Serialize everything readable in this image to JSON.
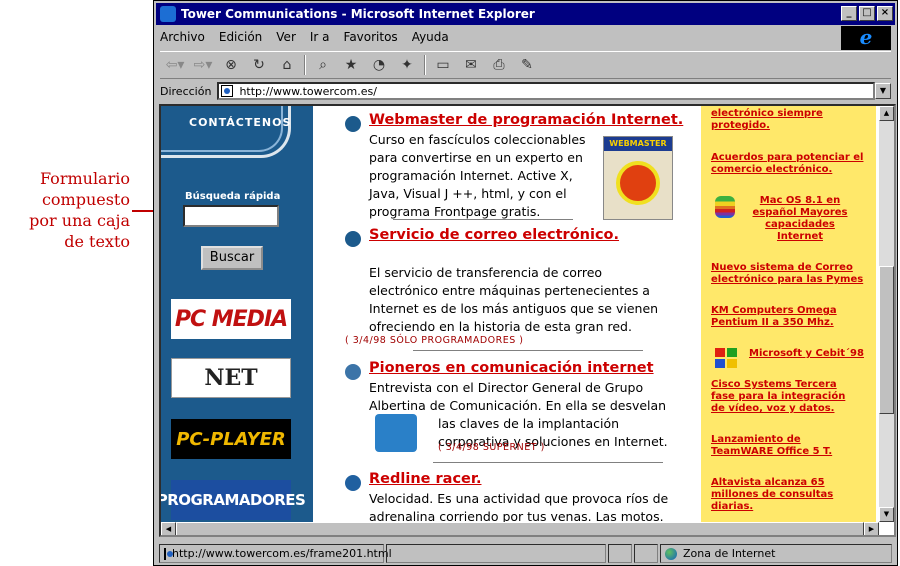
{
  "annotation": {
    "lines": [
      "Formulario",
      "compuesto",
      "por una caja",
      "de texto"
    ]
  },
  "window": {
    "title": "Tower Communications - Microsoft Internet Explorer",
    "buttons": [
      "_",
      "□",
      "×"
    ]
  },
  "menu": [
    "Archivo",
    "Edición",
    "Ver",
    "Ir a",
    "Favoritos",
    "Ayuda"
  ],
  "toolbar_icons": [
    "back-arrow-icon",
    "forward-arrow-icon",
    "stop-icon",
    "refresh-icon",
    "home-icon",
    "search-icon",
    "favorites-icon",
    "history-icon",
    "channels-icon",
    "fullscreen-icon",
    "mail-icon",
    "print-icon",
    "edit-icon"
  ],
  "address": {
    "label": "Dirección",
    "url": "http://www.towercom.es/"
  },
  "left": {
    "heading": "CONTÁCTENOS",
    "search_label": "Búsqueda rápida",
    "search_value": "",
    "button": "Buscar",
    "banners": [
      "PC MEDIA",
      "NET",
      "PC-PLAYER",
      "PROGRAMADORES"
    ]
  },
  "articles": [
    {
      "title": "Webmaster de programación Internet.",
      "lines": [
        "Curso en fascículos coleccionables",
        "para convertirse en un experto en",
        "programación Internet. Active X,",
        "Java, Visual J ++, html, y con el",
        "programa Frontpage gratis."
      ],
      "date": ""
    },
    {
      "title": "Servicio de correo electrónico.",
      "lines": [
        "El servicio de transferencia de correo",
        "electrónico entre máquinas pertenecientes a",
        "Internet es de los más antiguos que se vienen",
        "ofreciendo en la historia de esta gran red."
      ],
      "date": "( 3/4/98 SÓLO PROGRAMADORES )"
    },
    {
      "title": "Pioneros en comunicación internet",
      "lines": [
        "Entrevista con el Director General de Grupo",
        "Albertina de Comunicación. En ella se desvelan",
        "las claves de la implantación",
        "corporativa y soluciones en Internet."
      ],
      "date": "( 3/4/98 SUPERNET )"
    },
    {
      "title": "Redline racer.",
      "lines": [
        "Velocidad. Es una actividad que provoca ríos de",
        "adrenalina corriendo por tus venas. Las motos."
      ],
      "date": ""
    }
  ],
  "magazine_label": "WEBMASTER",
  "news": [
    "electrónico siempre protegido.",
    "Acuerdos para potenciar el comercio electrónico.",
    "Mac OS 8.1 en español Mayores capacidades Internet",
    "Nuevo sistema de Correo electrónico para las Pymes",
    "KM Computers Omega Pentium II a 350 Mhz.",
    "Microsoft y Cebit´98",
    "Cisco Systems Tercera fase para la integración de vídeo, voz y datos.",
    "Lanzamiento de TeamWARE Office 5 T.",
    "Altavista alcanza 65 millones de consultas diarias."
  ],
  "status": {
    "url": "http://www.towercom.es/frame201.html",
    "zone": "Zona de Internet"
  },
  "colors": {
    "link": "#cc0000",
    "left_bg": "#1c5a8c",
    "right_bg": "#ffe86a",
    "title_bg": "#000080"
  }
}
